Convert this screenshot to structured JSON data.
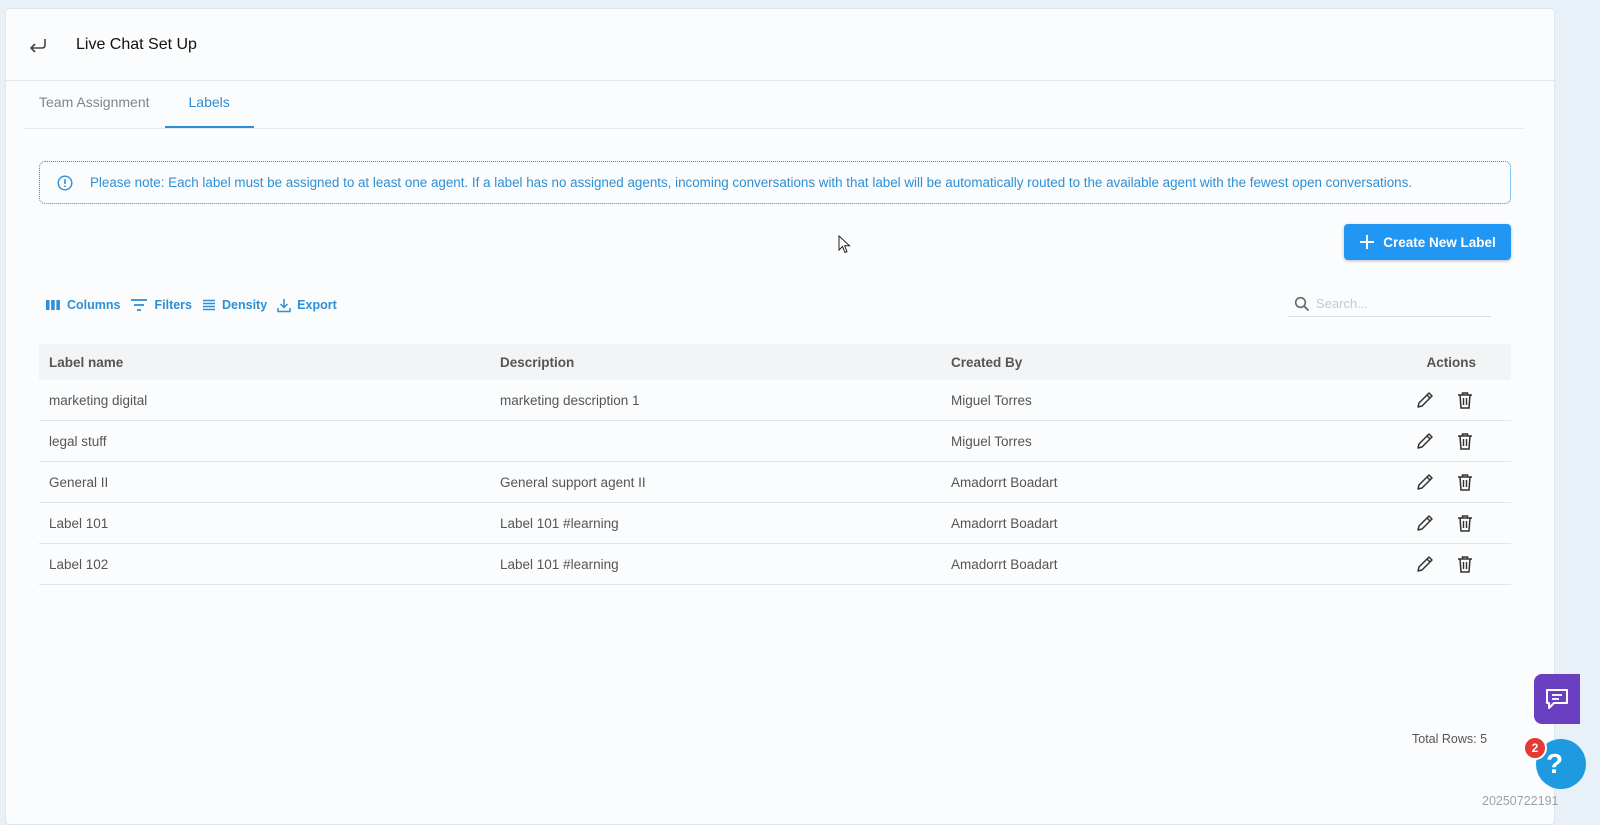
{
  "header": {
    "back_icon": "back-arrow-icon",
    "title": "Live Chat Set Up"
  },
  "tabs": [
    {
      "label": "Team Assignment",
      "active": false
    },
    {
      "label": "Labels",
      "active": true
    }
  ],
  "notice": {
    "icon": "info-icon",
    "text": "Please note: Each label must be assigned to at least one agent. If a label has no assigned agents, incoming conversations with that label will be automatically routed to the available agent with the fewest open conversations."
  },
  "create_button": {
    "icon": "plus-icon",
    "label": "Create New Label"
  },
  "toolbar": {
    "columns": "Columns",
    "filters": "Filters",
    "density": "Density",
    "export": "Export"
  },
  "search": {
    "placeholder": "Search...",
    "value": ""
  },
  "table": {
    "headers": {
      "label_name": "Label name",
      "description": "Description",
      "created_by": "Created By",
      "actions": "Actions"
    },
    "rows": [
      {
        "label_name": "marketing digital",
        "description": "marketing description 1",
        "created_by": "Miguel Torres"
      },
      {
        "label_name": "legal stuff",
        "description": "",
        "created_by": "Miguel Torres"
      },
      {
        "label_name": "General II",
        "description": "General support agent II",
        "created_by": "Amadorrt Boadart"
      },
      {
        "label_name": "Label 101",
        "description": "Label 101 #learning",
        "created_by": "Amadorrt Boadart"
      },
      {
        "label_name": "Label 102",
        "description": "Label 101 #learning",
        "created_by": "Amadorrt Boadart"
      }
    ]
  },
  "footer": {
    "total_rows": "Total Rows: 5"
  },
  "widgets": {
    "help_badge_count": "2",
    "help_label": "?"
  },
  "timestamp": "20250722191",
  "colors": {
    "accent": "#2d8fd5",
    "button": "#2196f3",
    "chat_widget": "#6a3fc1",
    "badge": "#e53935"
  }
}
